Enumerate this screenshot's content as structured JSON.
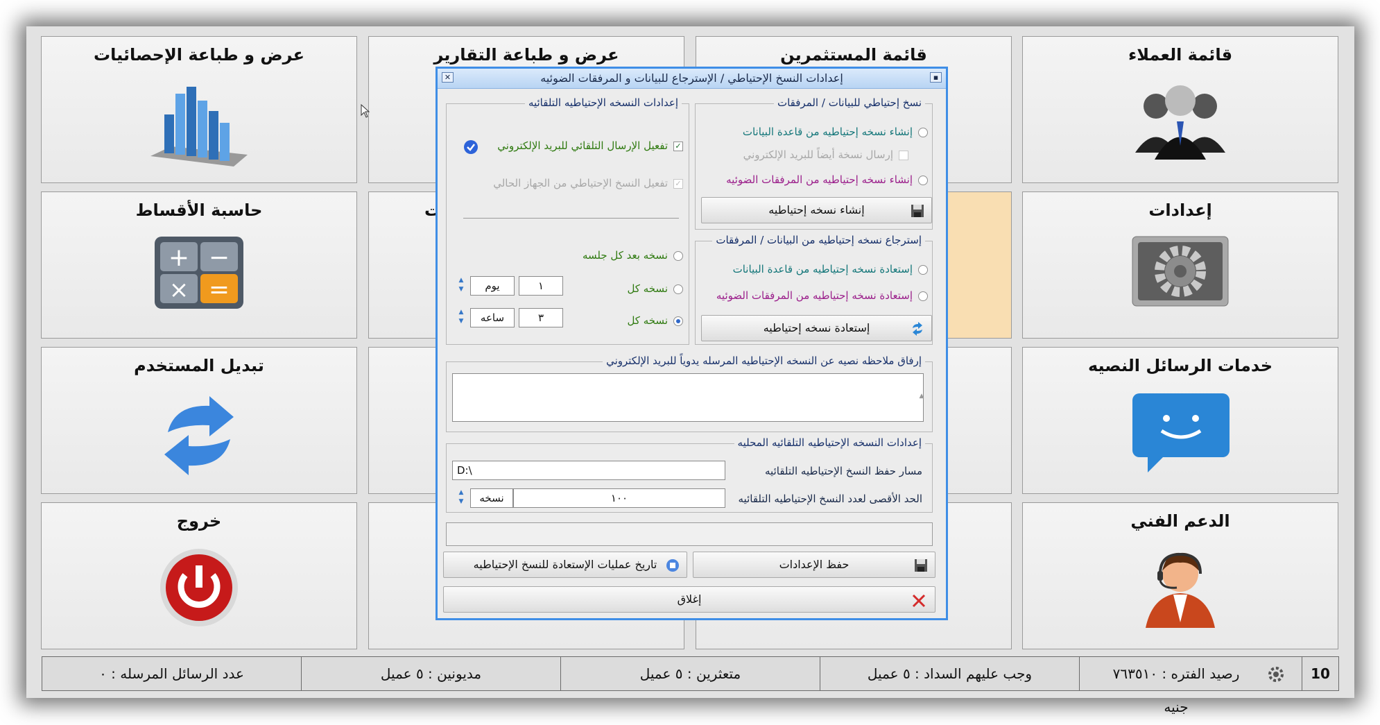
{
  "tiles": {
    "statistics": "عرض و طباعة الإحصائيات",
    "reports": "عرض و طباعة التقارير",
    "investors": "قائمة المستثمرين",
    "clients": "قائمة العملاء",
    "installments": "حاسبة الأقساط",
    "settings": "إعدادات",
    "switch_user": "تبديل المستخدم",
    "sms": "خدمات الرسائل النصيه",
    "exit": "خروج",
    "support": "الدعم الفني",
    "partial_label": "ت"
  },
  "status": {
    "version": "10",
    "balance": "رصيد الفتره : ٧٦٣٥١٠ جنيه",
    "due": "وجب عليهم السداد : ٥ عميل",
    "late": "متعثرين : ٥ عميل",
    "debtors": "مديونين : ٥ عميل",
    "sent": "عدد الرسائل المرسله : ٠"
  },
  "dialog": {
    "title": "إعدادات النسخ الإحتياطي / الإسترجاع للبيانات و المرفقات الضوئيه",
    "backup": {
      "legend": "نسخ إحتياطي للبيانات / المرفقات",
      "db_option": "إنشاء نسخه إحتياطيه من قاعدة البيانات",
      "email_copy": "إرسال نسخة أيضاً للبريد الإلكتروني",
      "scans_option": "إنشاء نسخه إحتياطيه من المرفقات الضوئيه",
      "button": "إنشاء نسخه إحتياطيه"
    },
    "restore": {
      "legend": "إسترجاع نسخه إحتياطيه من البيانات / المرفقات",
      "db_option": "إستعادة نسخه إحتياطيه من قاعدة البيانات",
      "scans_option": "إستعادة نسخه إحتياطيه من المرفقات الضوئيه",
      "button": "إستعادة نسخه إحتياطيه"
    },
    "auto": {
      "legend": "إعدادات النسخه الإحتياطيه التلقائيه",
      "email_auto": "تفعيل الإرسال التلقائي للبريد الإلكتروني",
      "local_auto": "تفعيل النسخ الإحتياطي من الجهاز الحالي",
      "after_session": "نسخه بعد كل جلسه",
      "every_label": "نسخه كل",
      "every_days_value": "١",
      "every_days_unit": "يوم",
      "every_hours_value": "٣",
      "every_hours_unit": "ساعه"
    },
    "note": {
      "legend": "إرفاق ملاحظه نصيه عن النسخه الإحتياطيه المرسله يدوياً للبريد الإلكتروني",
      "value": ""
    },
    "local": {
      "legend": "إعدادات النسخه الإحتياطيه التلقائيه المحليه",
      "path_label": "مسار حفظ النسخ الإحتياطيه التلقائيه",
      "path_value": "D:\\",
      "max_label": "الحد الأقصى لعدد النسخ الإحتياطيه التلقائيه",
      "max_value": "١٠٠",
      "max_unit": "نسخه"
    },
    "save_button": "حفظ الإعدادات",
    "history_button": "تاريخ عمليات الإستعادة للنسخ الإحتياطيه",
    "close_button": "إغلاق"
  },
  "colors": {
    "accent": "#3f8ee6",
    "tile_bg": "#ececec",
    "tile_highlight": "#f9deb2"
  }
}
